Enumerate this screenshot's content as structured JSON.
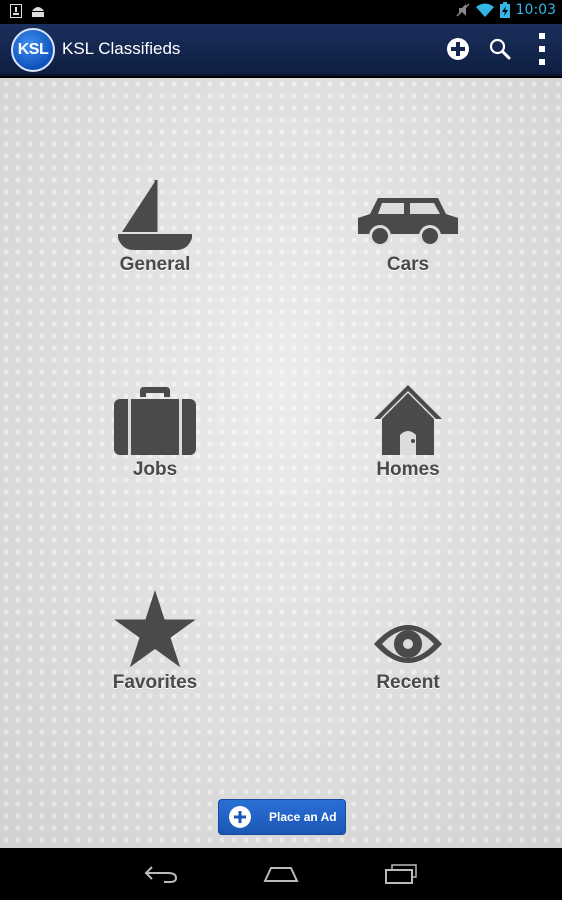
{
  "status_bar": {
    "time": "10:03"
  },
  "action_bar": {
    "logo_text": "KSL",
    "title": "KSL Classifieds",
    "icons": [
      "add-circle-icon",
      "search-icon",
      "overflow-menu-icon"
    ]
  },
  "categories": [
    {
      "label": "General",
      "icon": "sailboat-icon"
    },
    {
      "label": "Cars",
      "icon": "car-icon"
    },
    {
      "label": "Jobs",
      "icon": "briefcase-icon"
    },
    {
      "label": "Homes",
      "icon": "house-icon"
    },
    {
      "label": "Favorites",
      "icon": "star-icon"
    },
    {
      "label": "Recent",
      "icon": "eye-icon"
    }
  ],
  "place_ad": {
    "label": "Place an Ad"
  },
  "colors": {
    "action_bar": "#12264f",
    "accent": "#33b5e5",
    "icon": "#4a4a4a",
    "button": "#1f5fc4"
  }
}
